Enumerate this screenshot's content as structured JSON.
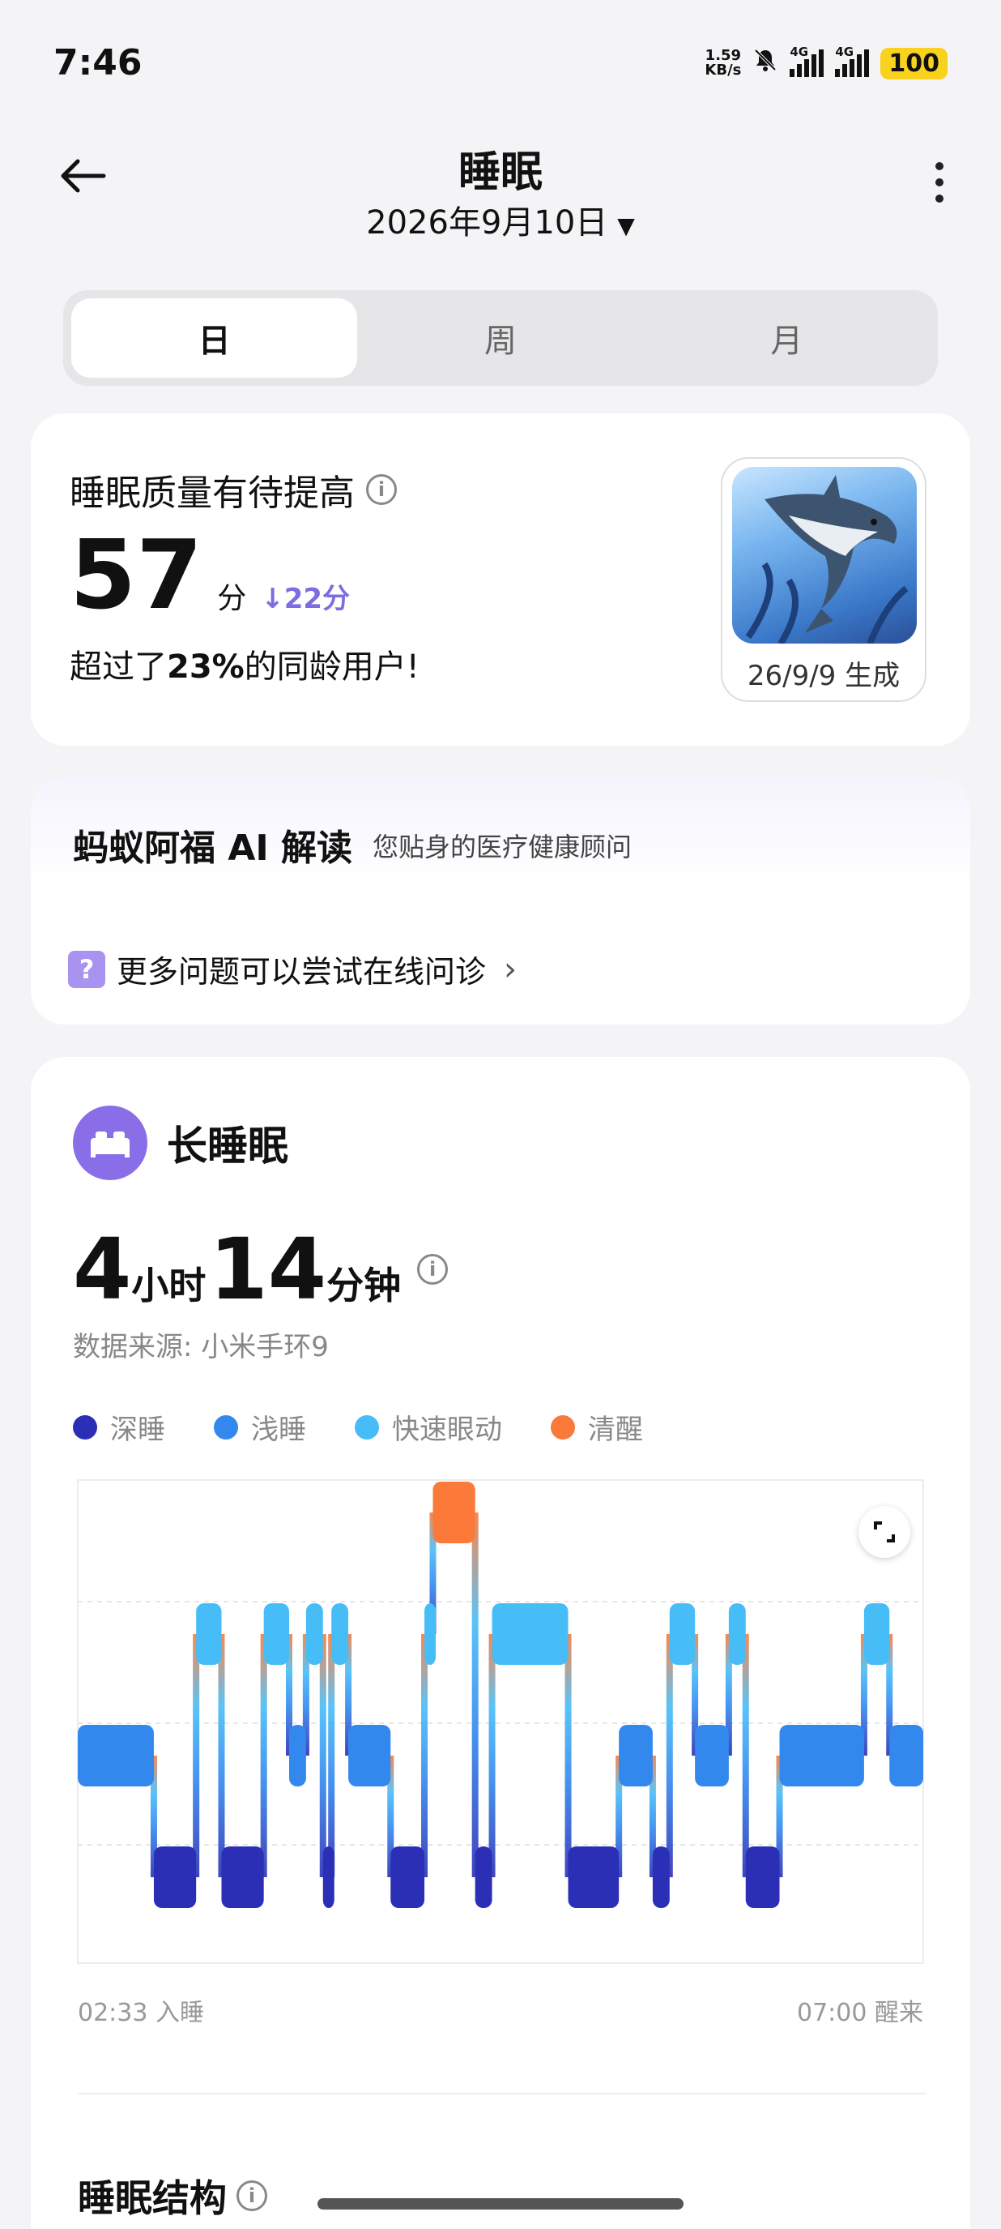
{
  "status": {
    "time": "7:46",
    "netspeed_value": "1.59",
    "netspeed_unit": "KB/s",
    "network_1": "4G",
    "network_2": "4G",
    "battery": "100",
    "icons": [
      "bell-muted-icon",
      "signal-icon",
      "signal-icon"
    ]
  },
  "header": {
    "title": "睡眠",
    "date": "2026年9月10日",
    "back_icon": "arrow-left-icon",
    "more_icon": "more-vertical-icon"
  },
  "tabs": [
    {
      "label": "日",
      "active": true
    },
    {
      "label": "周",
      "active": false
    },
    {
      "label": "月",
      "active": false
    }
  ],
  "score_card": {
    "heading": "睡眠质量有待提高",
    "score": "57",
    "unit": "分",
    "delta": "22分",
    "percent_prefix": "超过了",
    "percent_value": "23%",
    "percent_suffix": "的同龄用户!",
    "thumb_caption": "26/9/9 生成"
  },
  "ai_card": {
    "title": "蚂蚁阿福 AI 解读",
    "subtitle": "您贴身的医疗健康顾问",
    "link_text": "更多问题可以尝试在线问诊",
    "link_icon": "question-icon"
  },
  "sleep": {
    "title": "长睡眠",
    "hours": "4",
    "hours_unit": "小时",
    "minutes": "14",
    "minutes_unit": "分钟",
    "source": "数据来源: 小米手环9",
    "legend": [
      {
        "label": "深睡",
        "color": "#2b2fb5"
      },
      {
        "label": "浅睡",
        "color": "#3388ee"
      },
      {
        "label": "快速眼动",
        "color": "#47bdf7"
      },
      {
        "label": "清醒",
        "color": "#fb7a3a"
      }
    ],
    "start_label": "02:33 入睡",
    "end_label": "07:00 醒来",
    "structure_title": "睡眠结构"
  },
  "chart_data": {
    "type": "hypnogram",
    "x_range": [
      "02:33",
      "07:00"
    ],
    "stages": [
      "清醒",
      "快速眼动",
      "浅睡",
      "深睡"
    ],
    "segments": [
      {
        "stage": "浅睡",
        "start": 0.0,
        "end": 0.09
      },
      {
        "stage": "深睡",
        "start": 0.09,
        "end": 0.14
      },
      {
        "stage": "快速眼动",
        "start": 0.14,
        "end": 0.17
      },
      {
        "stage": "深睡",
        "start": 0.17,
        "end": 0.22
      },
      {
        "stage": "快速眼动",
        "start": 0.22,
        "end": 0.25
      },
      {
        "stage": "浅睡",
        "start": 0.25,
        "end": 0.27
      },
      {
        "stage": "快速眼动",
        "start": 0.27,
        "end": 0.29
      },
      {
        "stage": "深睡",
        "start": 0.29,
        "end": 0.3
      },
      {
        "stage": "快速眼动",
        "start": 0.3,
        "end": 0.32
      },
      {
        "stage": "浅睡",
        "start": 0.32,
        "end": 0.37
      },
      {
        "stage": "深睡",
        "start": 0.37,
        "end": 0.41
      },
      {
        "stage": "快速眼动",
        "start": 0.41,
        "end": 0.42
      },
      {
        "stage": "清醒",
        "start": 0.42,
        "end": 0.47
      },
      {
        "stage": "深睡",
        "start": 0.47,
        "end": 0.49
      },
      {
        "stage": "快速眼动",
        "start": 0.49,
        "end": 0.58
      },
      {
        "stage": "深睡",
        "start": 0.58,
        "end": 0.64
      },
      {
        "stage": "浅睡",
        "start": 0.64,
        "end": 0.68
      },
      {
        "stage": "深睡",
        "start": 0.68,
        "end": 0.7
      },
      {
        "stage": "快速眼动",
        "start": 0.7,
        "end": 0.73
      },
      {
        "stage": "浅睡",
        "start": 0.73,
        "end": 0.77
      },
      {
        "stage": "快速眼动",
        "start": 0.77,
        "end": 0.79
      },
      {
        "stage": "深睡",
        "start": 0.79,
        "end": 0.83
      },
      {
        "stage": "浅睡",
        "start": 0.83,
        "end": 0.93
      },
      {
        "stage": "快速眼动",
        "start": 0.93,
        "end": 0.96
      },
      {
        "stage": "浅睡",
        "start": 0.96,
        "end": 1.0
      }
    ]
  }
}
